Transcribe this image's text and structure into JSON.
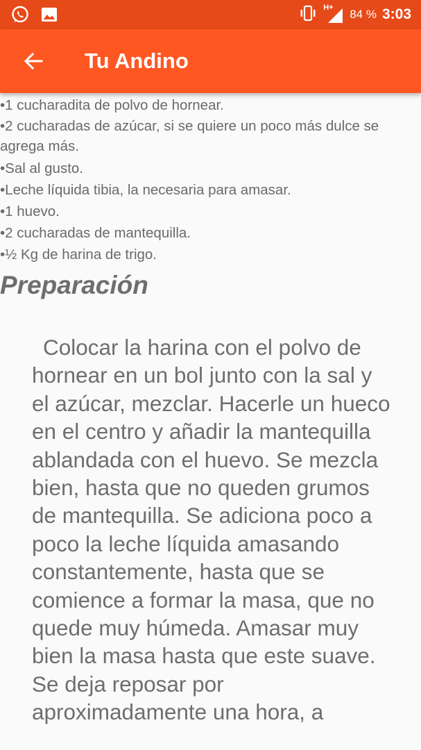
{
  "status_bar": {
    "battery": "84 %",
    "time": "3:03",
    "network": "H+",
    "icons": [
      "whatsapp-icon",
      "image-icon",
      "vibrate-icon",
      "signal-icon"
    ]
  },
  "app_bar": {
    "title": "Tu Andino",
    "back_icon": "arrow-back-icon"
  },
  "colors": {
    "status_bar": "#e64a19",
    "app_bar": "#ff5722",
    "text": "#6e6e6e",
    "background": "#fafafa"
  },
  "ingredients": [
    "•1 cucharadita de polvo de hornear.",
    "•2 cucharadas de azúcar, si se quiere un poco más dulce se agrega más.",
    "•Sal al gusto.",
    "•Leche líquida tibia, la necesaria para amasar.",
    "•1 huevo.",
    "•2 cucharadas de mantequilla.",
    "•½ Kg de harina de trigo."
  ],
  "preparation": {
    "heading": "Preparación",
    "text": "Colocar la harina con el polvo de hornear en un bol junto con la sal y el azúcar, mezclar. Hacerle un hueco en el centro y añadir la mantequilla ablandada con el huevo. Se mezcla bien, hasta que no queden grumos de mantequilla. Se adiciona poco a poco la leche líquida amasando constantemente, hasta que se comience a formar la masa, que no quede muy húmeda. Amasar muy bien la masa hasta que este suave. Se deja reposar por aproximadamente una hora, a"
  }
}
